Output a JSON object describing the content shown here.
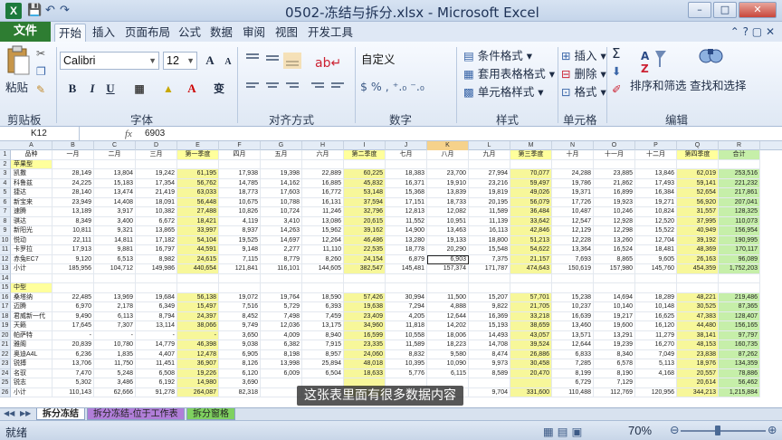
{
  "window": {
    "title": "0502-冻结与拆分.xlsx - Microsoft Excel",
    "app_icon": "X",
    "qa_undo": "↶",
    "qa_redo": "↷",
    "qa_save": "💾",
    "minimize": "–",
    "maximize": "□",
    "close": "✕"
  },
  "tabs": [
    "文件",
    "开始",
    "插入",
    "页面布局",
    "公式",
    "数据",
    "审阅",
    "视图",
    "开发工具"
  ],
  "active_tab": "开始",
  "ribbon": {
    "clipboard": {
      "paste": "粘贴",
      "label": "剪贴板"
    },
    "font": {
      "name": "Calibri",
      "size": "12",
      "bold": "B",
      "italic": "I",
      "underline": "U",
      "wen": "变",
      "label": "字体",
      "grow": "A",
      "shrink": "A"
    },
    "alignment": {
      "label": "对齐方式"
    },
    "number": {
      "format": "自定义",
      "label": "数字"
    },
    "styles": {
      "cond_format": "条件格式",
      "table_format": "套用表格格式",
      "cell_style": "单元格样式",
      "label": "样式"
    },
    "cells": {
      "insert": "插入",
      "delete": "删除",
      "format": "格式",
      "label": "单元格"
    },
    "editing": {
      "sigma": "Σ",
      "sort": "排序和筛选",
      "find": "查找和选择",
      "label": "编辑"
    }
  },
  "formula_bar": {
    "name_box": "K12",
    "fx": "fx",
    "value": "6903"
  },
  "columns": [
    "A",
    "B",
    "C",
    "D",
    "E",
    "F",
    "G",
    "H",
    "I",
    "J",
    "K",
    "L",
    "M",
    "N",
    "O",
    "P",
    "Q",
    "R"
  ],
  "selected_column": "K",
  "header_row": [
    "品种",
    "一月",
    "二月",
    "三月",
    "第一季度",
    "四月",
    "五月",
    "六月",
    "第二季度",
    "七月",
    "八月",
    "九月",
    "第三季度",
    "十月",
    "十一月",
    "十二月",
    "第四季度",
    "合计"
  ],
  "section1": "苹果型",
  "rows1": [
    [
      "凯撒",
      "28,149",
      "13,804",
      "19,242",
      "61,195",
      "17,938",
      "19,398",
      "22,889",
      "60,225",
      "18,383",
      "23,700",
      "27,994",
      "70,077",
      "24,288",
      "23,885",
      "13,846",
      "62,019",
      "253,516"
    ],
    [
      "科鲁兹",
      "24,225",
      "15,183",
      "17,354",
      "56,762",
      "14,785",
      "14,162",
      "16,885",
      "45,832",
      "16,371",
      "19,910",
      "23,216",
      "59,497",
      "19,786",
      "21,862",
      "17,493",
      "59,141",
      "221,232"
    ],
    [
      "捷达",
      "28,140",
      "13,474",
      "21,419",
      "63,033",
      "18,773",
      "17,603",
      "16,772",
      "53,148",
      "15,368",
      "13,839",
      "19,819",
      "49,026",
      "19,371",
      "16,899",
      "16,384",
      "52,654",
      "217,861"
    ],
    [
      "新宝来",
      "23,949",
      "14,408",
      "18,091",
      "56,448",
      "10,675",
      "10,788",
      "16,131",
      "37,594",
      "17,151",
      "18,733",
      "20,195",
      "56,079",
      "17,726",
      "19,923",
      "19,271",
      "56,920",
      "207,041"
    ],
    [
      "速腾",
      "13,189",
      "3,917",
      "10,382",
      "27,488",
      "10,826",
      "10,724",
      "11,246",
      "32,796",
      "12,813",
      "12,082",
      "11,589",
      "36,484",
      "10,487",
      "10,246",
      "10,824",
      "31,557",
      "128,325"
    ],
    [
      "骐达",
      "8,349",
      "3,400",
      "6,672",
      "18,421",
      "4,119",
      "3,410",
      "13,086",
      "20,615",
      "11,552",
      "10,951",
      "11,139",
      "33,642",
      "12,547",
      "12,928",
      "12,520",
      "37,995",
      "110,073"
    ],
    [
      "新阳光",
      "10,811",
      "9,321",
      "13,865",
      "33,997",
      "8,937",
      "14,263",
      "15,962",
      "39,162",
      "14,900",
      "13,463",
      "16,113",
      "42,846",
      "12,129",
      "12,298",
      "15,522",
      "40,949",
      "156,954"
    ],
    [
      "悦动",
      "22,111",
      "14,811",
      "17,182",
      "54,104",
      "19,525",
      "14,697",
      "12,264",
      "46,486",
      "13,280",
      "19,133",
      "18,800",
      "51,213",
      "12,228",
      "13,260",
      "12,704",
      "39,192",
      "190,995"
    ],
    [
      "卡罗拉",
      "17,913",
      "9,881",
      "16,797",
      "44,591",
      "9,148",
      "2,277",
      "11,110",
      "22,535",
      "18,778",
      "20,290",
      "15,548",
      "54,622",
      "13,364",
      "16,524",
      "18,481",
      "48,369",
      "170,117"
    ],
    [
      "赤兔EC7",
      "9,120",
      "6,513",
      "8,982",
      "24,615",
      "7,115",
      "8,779",
      "8,260",
      "24,154",
      "6,879",
      "6,903",
      "7,375",
      "21,157",
      "7,693",
      "8,865",
      "9,605",
      "26,163",
      "96,089"
    ],
    [
      "小计",
      "185,956",
      "104,712",
      "149,986",
      "440,654",
      "121,841",
      "116,101",
      "144,605",
      "382,547",
      "145,481",
      "157,374",
      "171,787",
      "474,643",
      "150,619",
      "157,980",
      "145,760",
      "454,359",
      "1,752,203"
    ]
  ],
  "section2": "中型",
  "rows2": [
    [
      "桑塔纳",
      "22,485",
      "13,969",
      "19,684",
      "56,138",
      "19,072",
      "19,764",
      "18,590",
      "57,426",
      "30,994",
      "11,500",
      "15,207",
      "57,701",
      "15,238",
      "14,694",
      "18,289",
      "48,221",
      "219,486"
    ],
    [
      "迈腾",
      "6,970",
      "2,178",
      "6,349",
      "15,497",
      "7,516",
      "5,729",
      "6,393",
      "19,638",
      "7,294",
      "4,888",
      "9,822",
      "21,705",
      "10,237",
      "10,140",
      "10,148",
      "30,525",
      "87,365"
    ],
    [
      "君威新一代",
      "9,490",
      "6,113",
      "8,794",
      "24,397",
      "8,452",
      "7,498",
      "7,459",
      "23,409",
      "4,205",
      "12,644",
      "16,369",
      "33,218",
      "16,639",
      "19,217",
      "16,625",
      "47,383",
      "128,407"
    ],
    [
      "天籁",
      "17,645",
      "7,307",
      "13,114",
      "38,066",
      "9,749",
      "12,036",
      "13,175",
      "34,960",
      "11,818",
      "14,202",
      "15,193",
      "38,659",
      "13,460",
      "19,600",
      "16,120",
      "44,480",
      "156,165"
    ],
    [
      "帕萨特",
      "-",
      "-",
      "-",
      "-",
      "3,650",
      "4,009",
      "8,940",
      "16,599",
      "10,558",
      "18,006",
      "14,493",
      "43,057",
      "13,571",
      "13,291",
      "11,279",
      "38,141",
      "97,797"
    ],
    [
      "雅阁",
      "20,839",
      "10,780",
      "14,779",
      "46,398",
      "9,038",
      "6,382",
      "7,915",
      "23,335",
      "11,589",
      "18,223",
      "14,708",
      "39,524",
      "12,644",
      "19,239",
      "16,270",
      "48,153",
      "160,735"
    ],
    [
      "奥迪A4L",
      "6,236",
      "1,835",
      "4,407",
      "12,478",
      "6,905",
      "8,198",
      "8,957",
      "24,060",
      "8,832",
      "9,580",
      "8,474",
      "26,886",
      "6,833",
      "8,340",
      "7,049",
      "23,838",
      "87,262"
    ],
    [
      "锐搏",
      "13,706",
      "11,750",
      "11,451",
      "36,907",
      "8,126",
      "13,998",
      "25,894",
      "48,018",
      "10,395",
      "10,090",
      "9,973",
      "30,458",
      "7,285",
      "6,578",
      "5,113",
      "18,976",
      "134,359"
    ],
    [
      "名驭",
      "7,470",
      "5,248",
      "6,508",
      "19,226",
      "6,120",
      "6,009",
      "6,504",
      "18,633",
      "5,776",
      "6,115",
      "8,589",
      "20,470",
      "8,199",
      "8,190",
      "4,168",
      "20,557",
      "78,886"
    ],
    [
      "锐志",
      "5,302",
      "3,486",
      "6,192",
      "14,980",
      "3,690",
      "",
      "",
      "",
      "",
      "",
      "",
      "",
      "6,729",
      "7,129",
      "",
      "20,614",
      "56,462"
    ],
    [
      "小计",
      "110,143",
      "62,666",
      "91,278",
      "264,087",
      "82,318",
      "",
      "",
      "",
      "",
      "",
      "9,704",
      "331,600",
      "110,488",
      "112,769",
      "120,956",
      "344,213",
      "1,215,884"
    ]
  ],
  "selected_cell": {
    "row": 12,
    "col": "K"
  },
  "sheets": [
    "拆分冻结",
    "拆分冻结-位于工作表",
    "拆分窗格"
  ],
  "active_sheet": "拆分冻结",
  "sheet_colors": {
    "拆分冻结": "#ffffff",
    "拆分冻结-位于工作表": "#b07ed8",
    "拆分窗格": "#7fd160"
  },
  "caption": "这张表里面有很多数据内容",
  "status": "就绪",
  "zoom": {
    "label": "70%",
    "level_percent": 70
  },
  "colors": {
    "accent": "#2e7d32",
    "highlight": "#ffff9c",
    "total": "#c6efa9"
  }
}
